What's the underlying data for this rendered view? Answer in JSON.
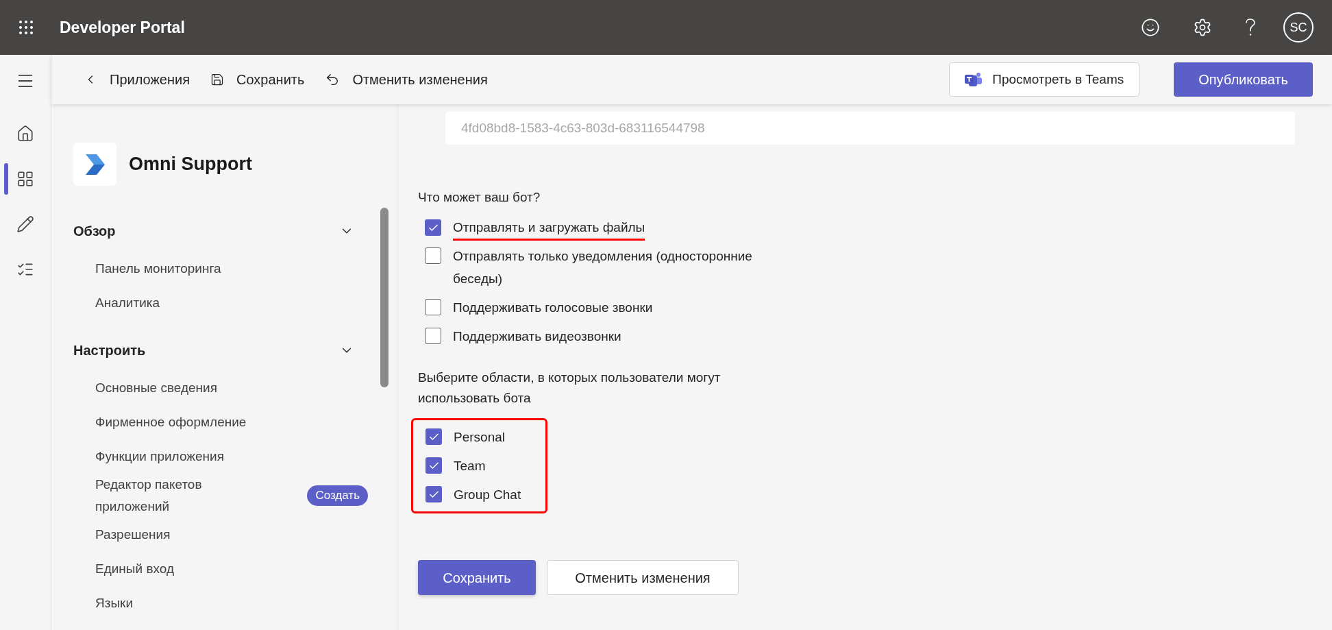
{
  "app_bar": {
    "title": "Developer Portal",
    "avatar": "SC"
  },
  "toolbar": {
    "back": "Приложения",
    "save": "Сохранить",
    "undo": "Отменить изменения",
    "preview": "Просмотреть в Teams",
    "publish": "Опубликовать"
  },
  "rail": {
    "items": [
      {
        "selected": false
      },
      {
        "selected": true
      },
      {
        "selected": false
      },
      {
        "selected": false
      }
    ]
  },
  "sidebar": {
    "app_name": "Omni Support",
    "sections": [
      {
        "title": "Обзор",
        "expanded": true,
        "items": [
          {
            "label": "Панель мониторинга"
          },
          {
            "label": "Аналитика"
          }
        ]
      },
      {
        "title": "Настроить",
        "expanded": true,
        "items": [
          {
            "label": "Основные сведения"
          },
          {
            "label": "Фирменное оформление"
          },
          {
            "label": "Функции приложения"
          },
          {
            "label": "Редактор пакетов приложений",
            "badge": "Создать"
          },
          {
            "label": "Разрешения"
          },
          {
            "label": "Единый вход"
          },
          {
            "label": "Языки"
          }
        ]
      }
    ]
  },
  "main": {
    "id_field": {
      "value": "4fd08bd8-1583-4c63-803d-683116544798",
      "disabled": true
    },
    "capabilities": {
      "label": "Что может ваш бот?",
      "options": [
        {
          "label": "Отправлять и загружать файлы",
          "checked": true,
          "highlighted": true
        },
        {
          "label": "Отправлять только уведомления (односторонние беседы)",
          "checked": false,
          "highlighted": false
        },
        {
          "label": "Поддерживать голосовые звонки",
          "checked": false,
          "highlighted": false
        },
        {
          "label": "Поддерживать видеозвонки",
          "checked": false,
          "highlighted": false
        }
      ]
    },
    "scopes": {
      "label": "Выберите области, в которых пользователи могут использовать бота",
      "highlighted": true,
      "options": [
        {
          "label": "Personal",
          "checked": true,
          "highlighted": false
        },
        {
          "label": "Team",
          "checked": true,
          "highlighted": false
        },
        {
          "label": "Group Chat",
          "checked": true,
          "highlighted": false
        }
      ]
    },
    "actions": {
      "save": "Сохранить",
      "cancel": "Отменить изменения"
    }
  }
}
